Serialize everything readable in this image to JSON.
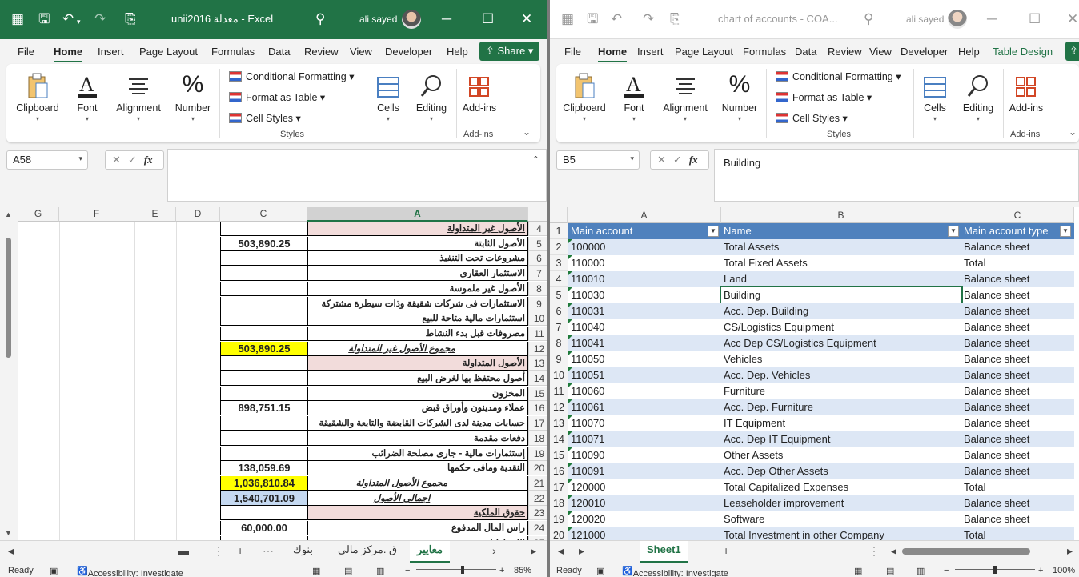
{
  "w1": {
    "title": "unii2016 معدلة - Excel",
    "user": "ali sayed",
    "menu": [
      "File",
      "Home",
      "Insert",
      "Page Layout",
      "Formulas",
      "Data",
      "Review",
      "View",
      "Developer",
      "Help"
    ],
    "share": "Share",
    "ribbon": {
      "clipboard": "Clipboard",
      "font": "Font",
      "alignment": "Alignment",
      "number": "Number",
      "cond_format": "Conditional Formatting",
      "format_table": "Format as Table",
      "cell_styles": "Cell Styles",
      "styles": "Styles",
      "cells": "Cells",
      "editing": "Editing",
      "addins": "Add-ins",
      "addins_group": "Add-ins"
    },
    "namebox": "A58",
    "formula": "",
    "columns": [
      "G",
      "F",
      "E",
      "D",
      "C",
      "A"
    ],
    "rows": [
      {
        "n": "4",
        "a": "الأصول غير المتداولة",
        "c": "",
        "style": "pink-under"
      },
      {
        "n": "5",
        "a": "الأصول الثابتة",
        "c": "503,890.25",
        "style": ""
      },
      {
        "n": "6",
        "a": "مشروعات تحت التنفيذ",
        "c": "",
        "style": ""
      },
      {
        "n": "7",
        "a": "الاستثمار العقارى",
        "c": "",
        "style": ""
      },
      {
        "n": "8",
        "a": "الأصول غير ملموسة",
        "c": "",
        "style": ""
      },
      {
        "n": "9",
        "a": "الاستثمارات فى شركات شقيقة وذات سيطرة مشتركة",
        "c": "",
        "style": ""
      },
      {
        "n": "10",
        "a": "استثمارات مالية متاحة للبيع",
        "c": "",
        "style": ""
      },
      {
        "n": "11",
        "a": "مصروفات قبل بدء النشاط",
        "c": "",
        "style": ""
      },
      {
        "n": "12",
        "a": "مجموع الأصول غير المتداولة",
        "c": "503,890.25",
        "style": "yellow-total"
      },
      {
        "n": "13",
        "a": "الأصول المتداولة",
        "c": "",
        "style": "pink-under"
      },
      {
        "n": "14",
        "a": "أصول محتفظ بها لغرض البيع",
        "c": "",
        "style": ""
      },
      {
        "n": "15",
        "a": "المخزون",
        "c": "",
        "style": ""
      },
      {
        "n": "16",
        "a": "عملاء ومدينون وأوراق قبض",
        "c": "898,751.15",
        "style": ""
      },
      {
        "n": "17",
        "a": "حسابات مدينة لدى الشركات القابضة والتابعة والشقيقة",
        "c": "",
        "style": ""
      },
      {
        "n": "18",
        "a": "دفعات مقدمة",
        "c": "",
        "style": ""
      },
      {
        "n": "19",
        "a": "إستثمارات مالية - جارى مصلحة الضرائب",
        "c": "",
        "style": ""
      },
      {
        "n": "20",
        "a": "النقدية ومافى حكمها",
        "c": "138,059.69",
        "style": ""
      },
      {
        "n": "21",
        "a": "مجموع الأصول المتداولة",
        "c": "1,036,810.84",
        "style": "yellow-total"
      },
      {
        "n": "22",
        "a": "اجمالى الأصول",
        "c": "1,540,701.09",
        "style": "blue-total"
      },
      {
        "n": "23",
        "a": "حقوق الملكية",
        "c": "",
        "style": "pink-under"
      },
      {
        "n": "24",
        "a": "راس المال المدفوع",
        "c": "60,000.00",
        "style": ""
      },
      {
        "n": "25",
        "a": "الاحتياطيات",
        "c": "",
        "style": ""
      }
    ],
    "tabs": [
      "معايير",
      "ق .مركز مالى",
      "بنوك"
    ],
    "status": {
      "ready": "Ready",
      "accessibility": "Accessibility: Investigate",
      "zoom": "85%"
    }
  },
  "w2": {
    "title": "chart of accounts - COA...",
    "user": "ali sayed",
    "menu": [
      "File",
      "Home",
      "Insert",
      "Page Layout",
      "Formulas",
      "Data",
      "Review",
      "View",
      "Developer",
      "Help",
      "Table Design"
    ],
    "ribbon": {
      "clipboard": "Clipboard",
      "font": "Font",
      "alignment": "Alignment",
      "number": "Number",
      "cond_format": "Conditional Formatting",
      "format_table": "Format as Table",
      "cell_styles": "Cell Styles",
      "styles": "Styles",
      "cells": "Cells",
      "editing": "Editing",
      "addins": "Add-ins",
      "addins_group": "Add-ins"
    },
    "namebox": "B5",
    "formula": "Building",
    "columns": [
      "A",
      "B",
      "C"
    ],
    "header": {
      "n": "1",
      "a": "Main account",
      "b": "Name",
      "c": "Main account type"
    },
    "rows": [
      {
        "n": "2",
        "a": "100000",
        "b": "Total Assets",
        "c": "Balance sheet"
      },
      {
        "n": "3",
        "a": "110000",
        "b": "Total Fixed Assets",
        "c": "Total"
      },
      {
        "n": "4",
        "a": "110010",
        "b": "Land",
        "c": "Balance sheet"
      },
      {
        "n": "5",
        "a": "110030",
        "b": "Building",
        "c": "Balance sheet"
      },
      {
        "n": "6",
        "a": "110031",
        "b": "Acc. Dep. Building",
        "c": "Balance sheet"
      },
      {
        "n": "7",
        "a": "110040",
        "b": "CS/Logistics Equipment",
        "c": "Balance sheet"
      },
      {
        "n": "8",
        "a": "110041",
        "b": "Acc Dep CS/Logistics Equipment",
        "c": "Balance sheet"
      },
      {
        "n": "9",
        "a": "110050",
        "b": "Vehicles",
        "c": "Balance sheet"
      },
      {
        "n": "10",
        "a": "110051",
        "b": "Acc. Dep. Vehicles",
        "c": "Balance sheet"
      },
      {
        "n": "11",
        "a": "110060",
        "b": "Furniture",
        "c": "Balance sheet"
      },
      {
        "n": "12",
        "a": "110061",
        "b": "Acc. Dep. Furniture",
        "c": "Balance sheet"
      },
      {
        "n": "13",
        "a": "110070",
        "b": "IT Equipment",
        "c": "Balance sheet"
      },
      {
        "n": "14",
        "a": "110071",
        "b": "Acc. Dep IT Equipment",
        "c": "Balance sheet"
      },
      {
        "n": "15",
        "a": "110090",
        "b": "Other Assets",
        "c": "Balance sheet"
      },
      {
        "n": "16",
        "a": "110091",
        "b": "Acc. Dep Other Assets",
        "c": "Balance sheet"
      },
      {
        "n": "17",
        "a": "120000",
        "b": "Total Capitalized Expenses",
        "c": "Total"
      },
      {
        "n": "18",
        "a": "120010",
        "b": "Leaseholder improvement",
        "c": "Balance sheet"
      },
      {
        "n": "19",
        "a": "120020",
        "b": "Software",
        "c": "Balance sheet"
      },
      {
        "n": "20",
        "a": "121000",
        "b": "Total Investment in other Company",
        "c": "Total"
      }
    ],
    "tabs": [
      "Sheet1"
    ],
    "status": {
      "ready": "Ready",
      "accessibility": "Accessibility: Investigate",
      "zoom": "100%"
    }
  },
  "colors": {
    "excel_green": "#217346",
    "table_header": "#4f81bd",
    "band": "#dde7f5",
    "pink": "#f2dcdb",
    "yellow": "#ffff00",
    "light_blue": "#c5d9f1"
  }
}
